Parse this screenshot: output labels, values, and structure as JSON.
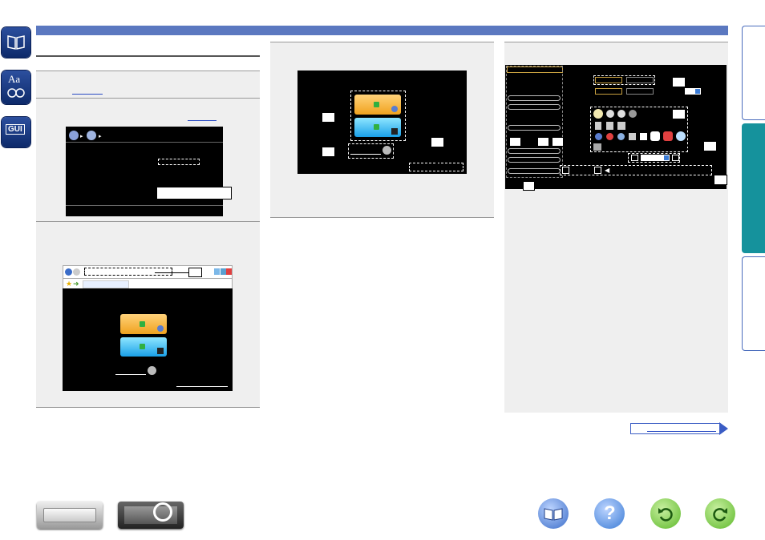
{
  "colors": {
    "header_bar": "#5b78c0",
    "sidebar_tab": "#1c3c86",
    "active_right_tab": "#15929c",
    "panel_bg": "#efefef",
    "help_blue": "#3a7bd5",
    "back_green": "#5db82a"
  },
  "left_nav": {
    "tab_1_icon": "book-icon",
    "tab_2_text": "Aa",
    "tab_3_text": "GUI"
  },
  "right_nav": {
    "tabs": [
      "tab-top",
      "tab-middle-active",
      "tab-bottom"
    ]
  },
  "bottom_nav": {
    "front_panel_icon": "receiver-front-icon",
    "rear_panel_icon": "receiver-rear-icon",
    "contents_icon": "open-book-icon",
    "help_icon": "question-mark-icon",
    "back_icon": "back-arrow-icon",
    "forward_icon": "forward-arrow-icon",
    "help_glyph": "?"
  }
}
